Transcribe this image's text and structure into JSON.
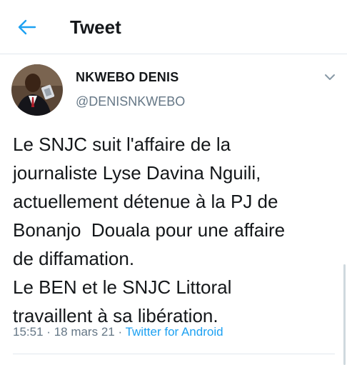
{
  "header": {
    "title": "Tweet",
    "back_icon": "arrow-left-icon"
  },
  "tweet": {
    "author_name": "NKWEBO DENIS",
    "author_handle": "@DENISNKWEBO",
    "text": "Le SNJC suit l'affaire de la\njournaliste Lyse Davina Nguili,\nactuellement détenue à la PJ de\nBonanjo  Douala pour une affaire\nde diffamation.\nLe BEN et le SNJC Littoral\ntravaillent à sa libération.",
    "time": "15:51",
    "separator": "·",
    "date": "18 mars 21",
    "source": "Twitter for Android"
  },
  "colors": {
    "accent": "#1da1f2",
    "secondary_text": "#657786",
    "primary_text": "#14171a"
  }
}
